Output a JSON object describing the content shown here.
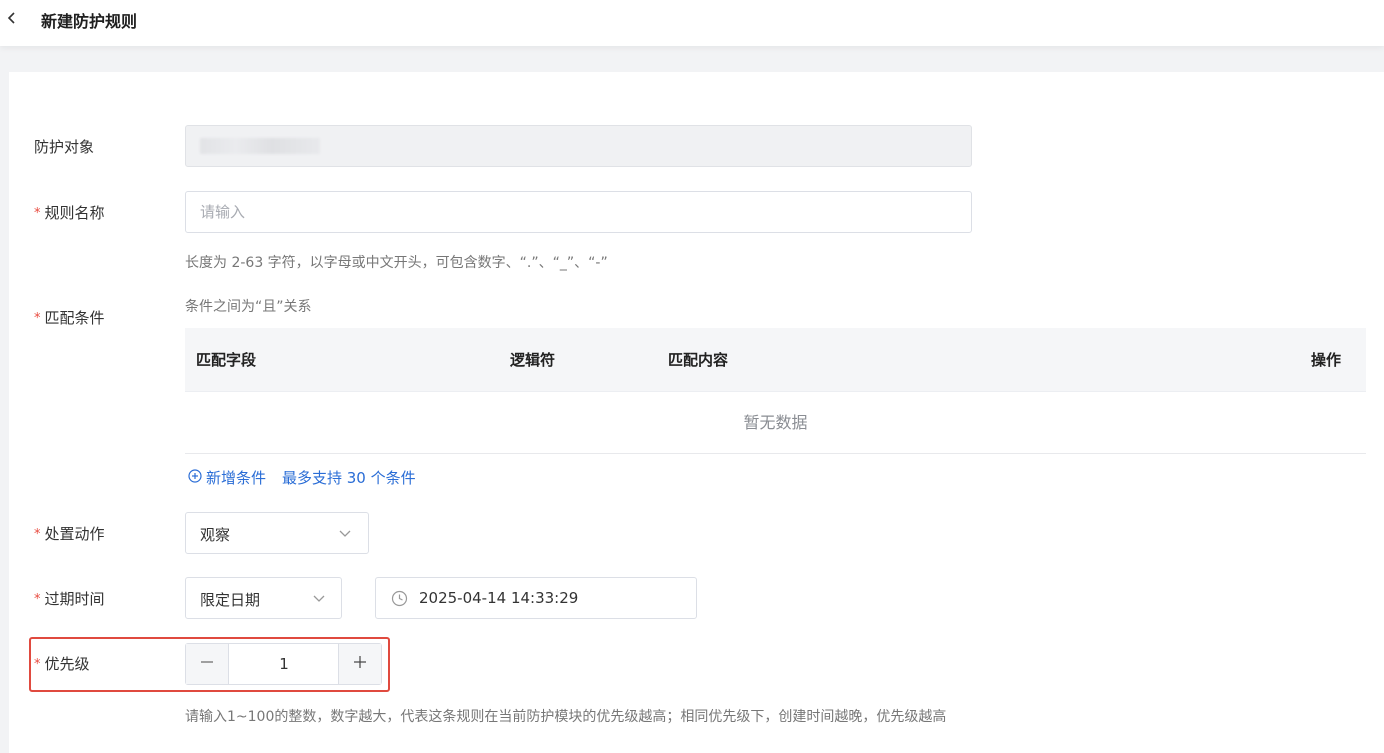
{
  "header": {
    "title": "新建防护规则"
  },
  "form": {
    "target": {
      "label": "防护对象"
    },
    "rule_name": {
      "required_mark": "*",
      "label": "规则名称",
      "placeholder": "请输入",
      "hint": "长度为 2-63 字符，以字母或中文开头，可包含数字、“.”、“_”、“-”"
    },
    "conditions": {
      "required_mark": "*",
      "label": "匹配条件",
      "hint": "条件之间为“且”关系",
      "columns": [
        "匹配字段",
        "逻辑符",
        "匹配内容",
        "操作"
      ],
      "empty_text": "暂无数据",
      "add_label": "新增条件",
      "max_label": "最多支持 30 个条件"
    },
    "action": {
      "required_mark": "*",
      "label": "处置动作",
      "value": "观察"
    },
    "expire": {
      "required_mark": "*",
      "label": "过期时间",
      "mode": "限定日期",
      "datetime": "2025-04-14 14:33:29"
    },
    "priority": {
      "required_mark": "*",
      "label": "优先级",
      "value": "1",
      "hint": "请输入1~100的整数，数字越大，代表这条规则在当前防护模块的优先级越高；相同优先级下，创建时间越晚，优先级越高"
    }
  },
  "colors": {
    "accent": "#2a6dd6",
    "required": "#e84a3f",
    "highlight": "#e04a3f"
  }
}
